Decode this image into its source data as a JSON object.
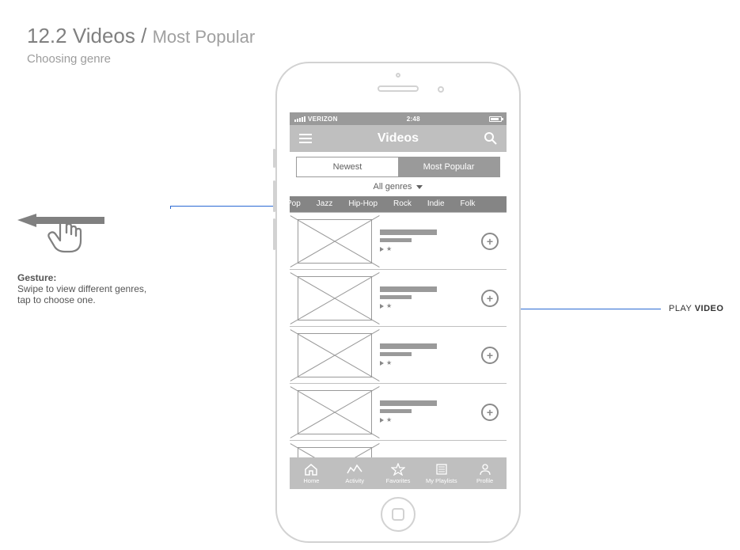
{
  "page": {
    "number": "12.2",
    "title": "Videos",
    "breadcrumb": "Most Popular",
    "subtitle": "Choosing genre"
  },
  "gesture": {
    "label_bold": "Gesture:",
    "label_text": "Swipe to view different genres, tap to choose one."
  },
  "statusbar": {
    "carrier": "VERIZON",
    "time": "2:48"
  },
  "navbar": {
    "title": "Videos"
  },
  "segments": {
    "left": "Newest",
    "right": "Most Popular",
    "active": "right"
  },
  "filter": {
    "label": "All genres"
  },
  "genres": [
    "Pop",
    "Jazz",
    "Hip-Hop",
    "Rock",
    "Indie",
    "Folk"
  ],
  "tabs": [
    {
      "key": "home",
      "label": "Home"
    },
    {
      "key": "activity",
      "label": "Activity"
    },
    {
      "key": "favorites",
      "label": "Favorites"
    },
    {
      "key": "playlists",
      "label": "My Playlists"
    },
    {
      "key": "profile",
      "label": "Profile"
    }
  ],
  "callout": {
    "play_video_1": "PLAY",
    "play_video_2": "VIDEO"
  }
}
